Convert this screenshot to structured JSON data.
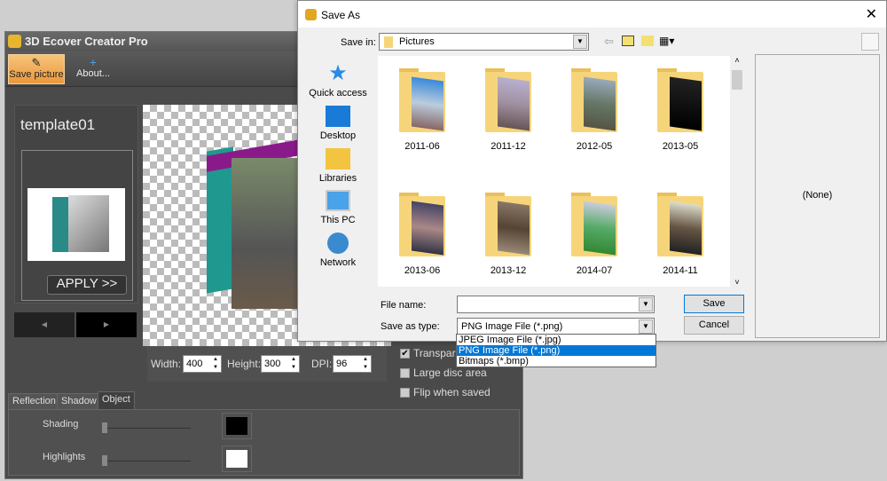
{
  "app": {
    "title": "3D Ecover Creator Pro",
    "toolbar": {
      "save_picture": "Save picture",
      "about": "About..."
    },
    "template": {
      "name": "template01",
      "apply": "APPLY >>"
    },
    "dimensions": {
      "width_label": "Width:",
      "width": "400",
      "height_label": "Height:",
      "height": "300",
      "dpi_label": "DPI:",
      "dpi": "96"
    },
    "options": {
      "transparent": "Transparent",
      "large_disc": "Large disc area",
      "flip": "Flip when saved"
    },
    "tabs": [
      "Reflection",
      "Shadow",
      "Object"
    ],
    "object": {
      "shading": "Shading",
      "highlights": "Highlights",
      "shading_color": "#000000",
      "highlights_color": "#ffffff"
    }
  },
  "dialog": {
    "title": "Save As",
    "save_in_label": "Save in:",
    "save_in": "Pictures",
    "places": [
      "Quick access",
      "Desktop",
      "Libraries",
      "This PC",
      "Network"
    ],
    "folders": [
      "2011-06",
      "2011-12",
      "2012-05",
      "2013-05",
      "2013-06",
      "2013-12",
      "2014-07",
      "2014-11"
    ],
    "preview": "(None)",
    "file_name_label": "File name:",
    "file_name": "",
    "type_label": "Save as type:",
    "type": "PNG Image File (*.png)",
    "type_options": [
      "JPEG Image File (*.jpg)",
      "PNG Image File (*.png)",
      "Bitmaps (*.bmp)"
    ],
    "save": "Save",
    "cancel": "Cancel"
  }
}
